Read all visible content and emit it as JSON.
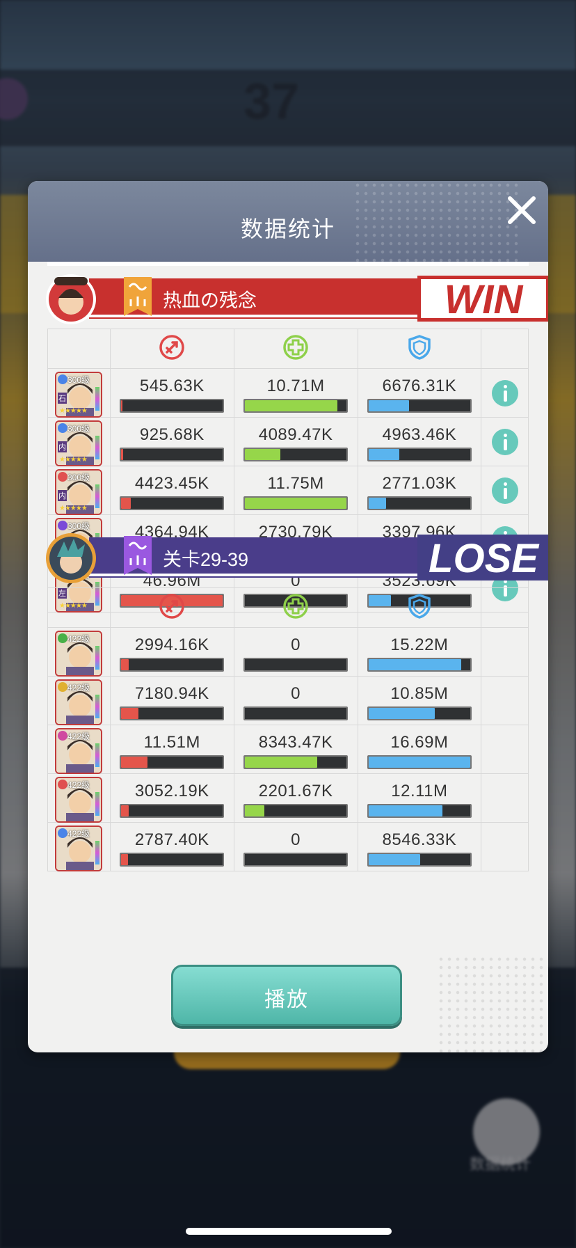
{
  "background": {
    "stage_number": "37",
    "stats_label": "数据统计"
  },
  "dialog": {
    "title": "数据统计",
    "play_label": "播放"
  },
  "stat_icons": [
    "damage-icon",
    "heal-icon",
    "shield-icon"
  ],
  "teams": [
    {
      "name": "热血の残念",
      "result": "WIN",
      "result_color": "#c8302e",
      "stripe_color": "#c8302e",
      "flag_color": "#f0a43a",
      "rows": [
        {
          "level": "300级",
          "tag": "石",
          "elem_color": "#4a84e8",
          "stars": "★★★★★",
          "damage": "545.63K",
          "damage_frac": 0.012,
          "heal": "10.71M",
          "heal_frac": 0.91,
          "shield": "6676.31K",
          "shield_frac": 0.4,
          "info": true
        },
        {
          "level": "300级",
          "tag": "内",
          "elem_color": "#4a84e8",
          "stars": "★★★★★",
          "damage": "925.68K",
          "damage_frac": 0.02,
          "heal": "4089.47K",
          "heal_frac": 0.35,
          "shield": "4963.46K",
          "shield_frac": 0.3,
          "info": true
        },
        {
          "level": "300级",
          "tag": "内",
          "elem_color": "#e05050",
          "stars": "★★★★★",
          "damage": "4423.45K",
          "damage_frac": 0.094,
          "heal": "11.75M",
          "heal_frac": 1.0,
          "shield": "2771.03K",
          "shield_frac": 0.17,
          "info": true
        },
        {
          "level": "300级",
          "tag": "内",
          "elem_color": "#7a4ad8",
          "stars": "★★★★★",
          "damage": "4364.94K",
          "damage_frac": 0.093,
          "heal": "2730.79K",
          "heal_frac": 0.23,
          "shield": "3397.96K",
          "shield_frac": 0.21,
          "info": true
        },
        {
          "level": "300级",
          "tag": "左",
          "elem_color": "#e05050",
          "stars": "★★★★★",
          "damage": "46.96M",
          "damage_frac": 1.0,
          "heal": "0",
          "heal_frac": 0,
          "shield": "3523.69K",
          "shield_frac": 0.22,
          "info": true
        }
      ]
    },
    {
      "name": "关卡29-39",
      "result": "LOSE",
      "result_color": "#433f86",
      "stripe_color": "#4a3d8a",
      "flag_color": "#9a58e0",
      "rows": [
        {
          "level": "422级",
          "tag": "",
          "elem_color": "#48b048",
          "stars": "",
          "damage": "2994.16K",
          "damage_frac": 0.07,
          "heal": "0",
          "heal_frac": 0,
          "shield": "15.22M",
          "shield_frac": 0.91,
          "info": false
        },
        {
          "level": "422级",
          "tag": "",
          "elem_color": "#e0b030",
          "stars": "",
          "damage": "7180.94K",
          "damage_frac": 0.17,
          "heal": "0",
          "heal_frac": 0,
          "shield": "10.85M",
          "shield_frac": 0.65,
          "info": false
        },
        {
          "level": "422级",
          "tag": "",
          "elem_color": "#d04aa0",
          "stars": "",
          "damage": "11.51M",
          "damage_frac": 0.26,
          "heal": "8343.47K",
          "heal_frac": 0.71,
          "shield": "16.69M",
          "shield_frac": 1.0,
          "info": false
        },
        {
          "level": "422级",
          "tag": "",
          "elem_color": "#e05050",
          "stars": "",
          "damage": "3052.19K",
          "damage_frac": 0.07,
          "heal": "2201.67K",
          "heal_frac": 0.19,
          "shield": "12.11M",
          "shield_frac": 0.73,
          "info": false
        },
        {
          "level": "422级",
          "tag": "",
          "elem_color": "#4a84e8",
          "stars": "",
          "damage": "2787.40K",
          "damage_frac": 0.065,
          "heal": "0",
          "heal_frac": 0,
          "shield": "8546.33K",
          "shield_frac": 0.51,
          "info": false
        }
      ]
    }
  ]
}
